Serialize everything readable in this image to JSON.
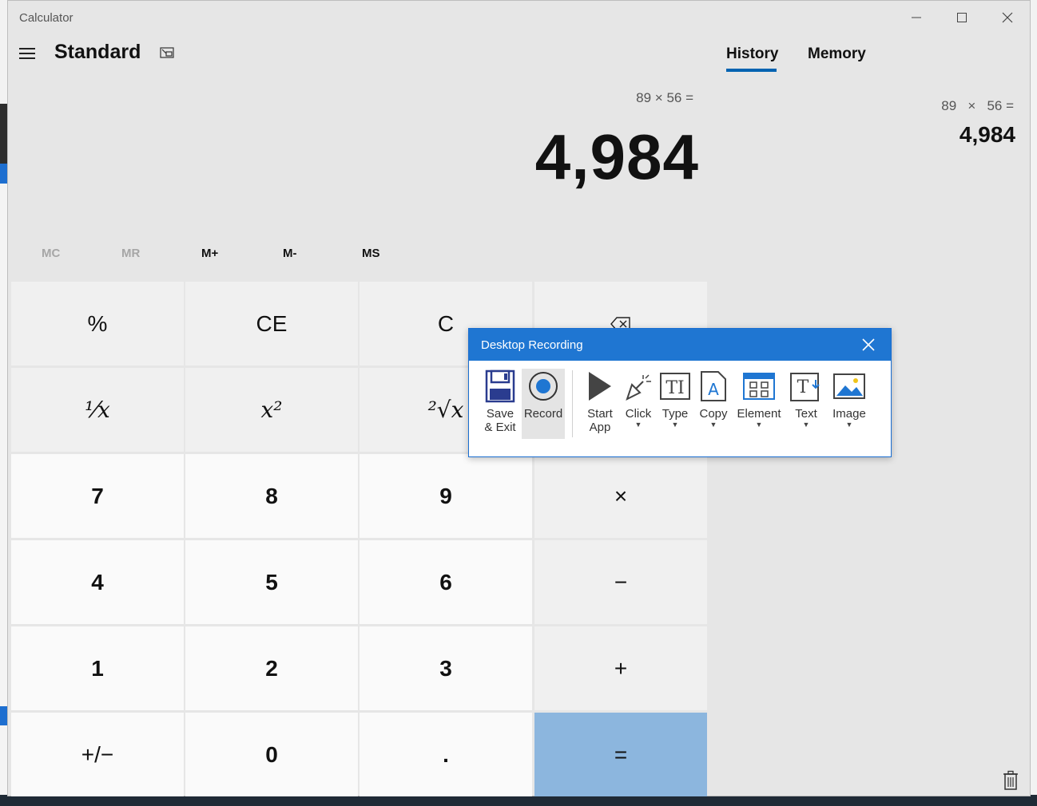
{
  "window": {
    "title": "Calculator",
    "minimize": "—",
    "maximize": "☐",
    "close": "✕"
  },
  "header": {
    "mode": "Standard"
  },
  "tabs": {
    "history": "History",
    "memory": "Memory"
  },
  "display": {
    "expression": "89 × 56 =",
    "result": "4,984"
  },
  "memory_buttons": [
    "MC",
    "MR",
    "M+",
    "M-",
    "MS"
  ],
  "keys": {
    "percent": "%",
    "ce": "CE",
    "c": "C",
    "backspace": "⌫",
    "reciprocal": "⅟x",
    "square": "x²",
    "sqrt": "²√x",
    "multiply": "×",
    "seven": "7",
    "eight": "8",
    "nine": "9",
    "minus": "−",
    "four": "4",
    "five": "5",
    "six": "6",
    "plus": "+",
    "one": "1",
    "two": "2",
    "three": "3",
    "equals": "=",
    "negate": "+/−",
    "zero": "0",
    "decimal": "."
  },
  "history": {
    "expr_a": "89",
    "op": "×",
    "expr_b": "56 =",
    "result": "4,984"
  },
  "recording": {
    "title": "Desktop Recording",
    "save_label_1": "Save",
    "save_label_2": "& Exit",
    "record": "Record",
    "start_1": "Start",
    "start_2": "App",
    "click": "Click",
    "type": "Type",
    "copy": "Copy",
    "element": "Element",
    "text": "Text",
    "image": "Image"
  },
  "colors": {
    "accent": "#0063b1",
    "equals_key": "#8cb6de",
    "rec_header": "#1f76d2"
  }
}
